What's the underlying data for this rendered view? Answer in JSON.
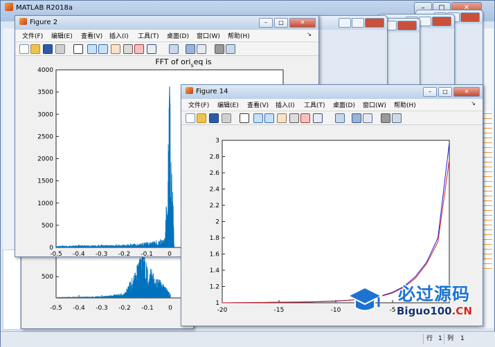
{
  "main_window": {
    "title": "MATLAB R2018a",
    "status": {
      "row_label": "行",
      "row_value": "1",
      "col_label": "列",
      "col_value": "1"
    }
  },
  "menu_items": [
    "文件(F)",
    "编辑(E)",
    "查看(V)",
    "插入(I)",
    "工具(T)",
    "桌面(D)",
    "窗口(W)",
    "帮助(H)"
  ],
  "figure2": {
    "title": "Figure 2",
    "chart_data": {
      "type": "line",
      "title_main": "FFT of ori",
      "title_sub": "s",
      "title_tail": "eq is",
      "xlim": [
        -0.5,
        0.5
      ],
      "ylim": [
        0,
        4000
      ],
      "xticks": [
        "-0.5",
        "-0.4",
        "-0.3",
        "-0.2",
        "-0.1",
        "0"
      ],
      "yticks": [
        "0",
        "500",
        "1000",
        "1500",
        "2000",
        "2500",
        "3000",
        "3500",
        "4000"
      ],
      "series": [
        {
          "color": "#0072bd",
          "x": [
            -0.5,
            -0.2,
            -0.1,
            -0.02,
            0,
            0.02
          ],
          "y": [
            40,
            70,
            120,
            220,
            3620,
            260
          ]
        }
      ]
    }
  },
  "figure_back": {
    "chart_data": {
      "type": "line",
      "xlim": [
        -0.5,
        0.5
      ],
      "ytick_visible": "500",
      "xticks": [
        "-0.5",
        "-0.4",
        "-0.3",
        "-0.2",
        "-0.1",
        "0"
      ],
      "series": [
        {
          "color": "#0072bd",
          "x": [
            -0.5,
            -0.3,
            -0.2,
            -0.15,
            -0.12,
            -0.1,
            0
          ],
          "y": [
            20,
            40,
            120,
            700,
            1200,
            800,
            120
          ]
        }
      ]
    }
  },
  "figure14": {
    "title": "Figure 14",
    "chart_data": {
      "type": "line",
      "xlim": [
        -20,
        0
      ],
      "ylim": [
        1,
        3
      ],
      "xticks": [
        "-20",
        "-15",
        "-10",
        "-5"
      ],
      "yticks": [
        "1",
        "1.2",
        "1.4",
        "1.6",
        "1.8",
        "2",
        "2.2",
        "2.4",
        "2.6",
        "2.8",
        "3"
      ],
      "series": [
        {
          "color": "#1f1fd6",
          "x": [
            -20,
            -16,
            -12,
            -10,
            -8,
            -6,
            -5,
            -4,
            -3,
            -2,
            -1,
            0
          ],
          "y": [
            1.0,
            1.005,
            1.012,
            1.022,
            1.04,
            1.085,
            1.13,
            1.2,
            1.32,
            1.5,
            1.8,
            2.97
          ]
        },
        {
          "color": "#d62020",
          "x": [
            -20,
            -16,
            -12,
            -10,
            -8,
            -6,
            -5,
            -4,
            -3,
            -2,
            -1,
            0
          ],
          "y": [
            1.0,
            1.005,
            1.011,
            1.02,
            1.038,
            1.08,
            1.12,
            1.19,
            1.3,
            1.48,
            1.75,
            2.76
          ]
        }
      ]
    }
  },
  "watermark": {
    "cn": "必过源码",
    "en_main": "Biguo100",
    "en_tail": ".CN"
  }
}
